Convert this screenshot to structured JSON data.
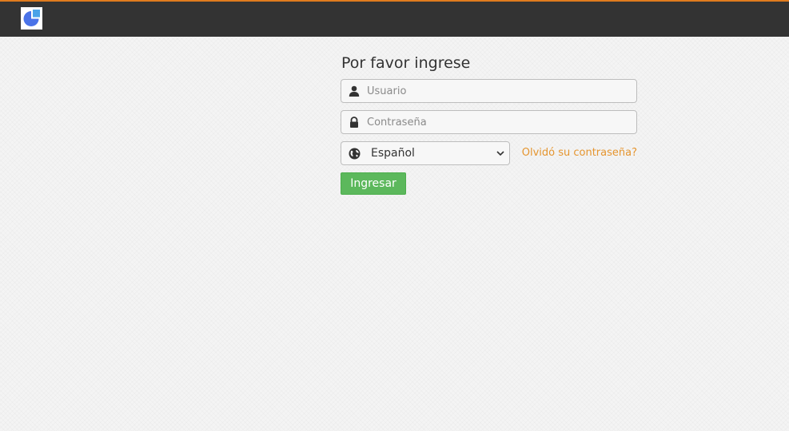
{
  "header": {
    "logo_icon": "pie-chart-logo-icon",
    "background_color": "#333333",
    "accent_color": "#e07b1e"
  },
  "login": {
    "title": "Por favor ingrese",
    "username": {
      "icon": "user-icon",
      "placeholder": "Usuario",
      "value": ""
    },
    "password": {
      "icon": "lock-icon",
      "placeholder": "Contraseña",
      "value": ""
    },
    "language": {
      "icon": "globe-icon",
      "selected": "Español"
    },
    "forgot_password_label": "Olvidó su contraseña?",
    "forgot_password_color": "#e5952f",
    "submit_label": "Ingresar",
    "submit_color": "#5cb85c"
  }
}
